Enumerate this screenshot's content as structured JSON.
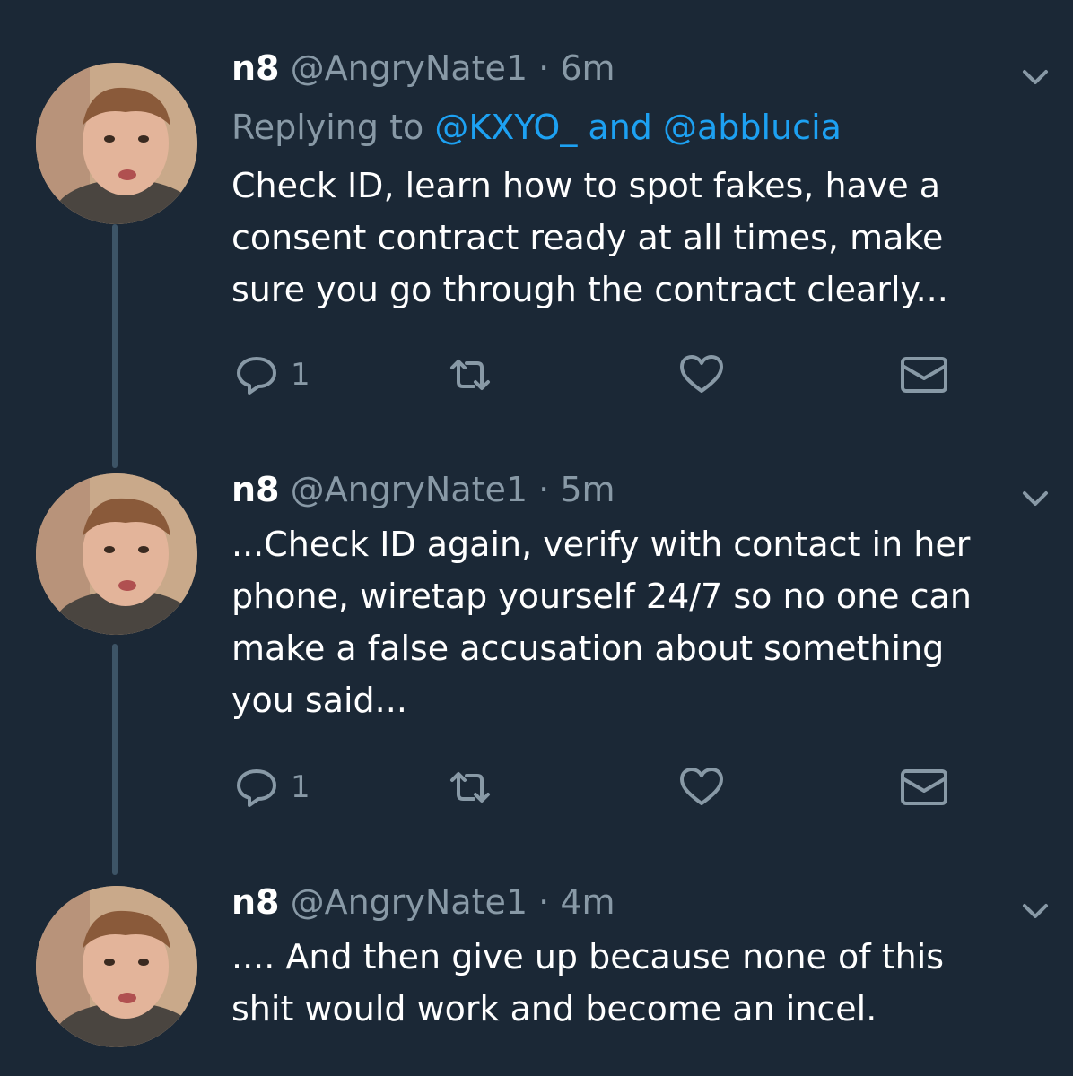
{
  "colors": {
    "background": "#1b2836",
    "secondary_text": "#8899a6",
    "link": "#1da1f2",
    "thread_line": "#3d5466"
  },
  "tweets": [
    {
      "name": "n8",
      "handle": "@AngryNate1",
      "separator": "·",
      "time": "6m",
      "reply_prefix": "Replying to",
      "reply_mention_1": "@KXYO_",
      "reply_and": "and",
      "reply_mention_2": "@abblucia",
      "text": "Check ID, learn how to spot fakes, have a\nconsent contract ready at all times, make\nsure you go through the contract clearly...",
      "reply_count": "1"
    },
    {
      "name": "n8",
      "handle": "@AngryNate1",
      "separator": "·",
      "time": "5m",
      "text": "...Check ID again, verify with contact in her\nphone, wiretap yourself 24/7 so no one can\nmake a false accusation about something\nyou said...",
      "reply_count": "1"
    },
    {
      "name": "n8",
      "handle": "@AngryNate1",
      "separator": "·",
      "time": "4m",
      "text": ".... And then give up because none of this\nshit would work and become an incel."
    }
  ],
  "icons": {
    "reply": "reply-icon",
    "retweet": "retweet-icon",
    "like": "heart-icon",
    "dm": "envelope-icon",
    "more": "chevron-down-icon",
    "avatar": "avatar"
  }
}
